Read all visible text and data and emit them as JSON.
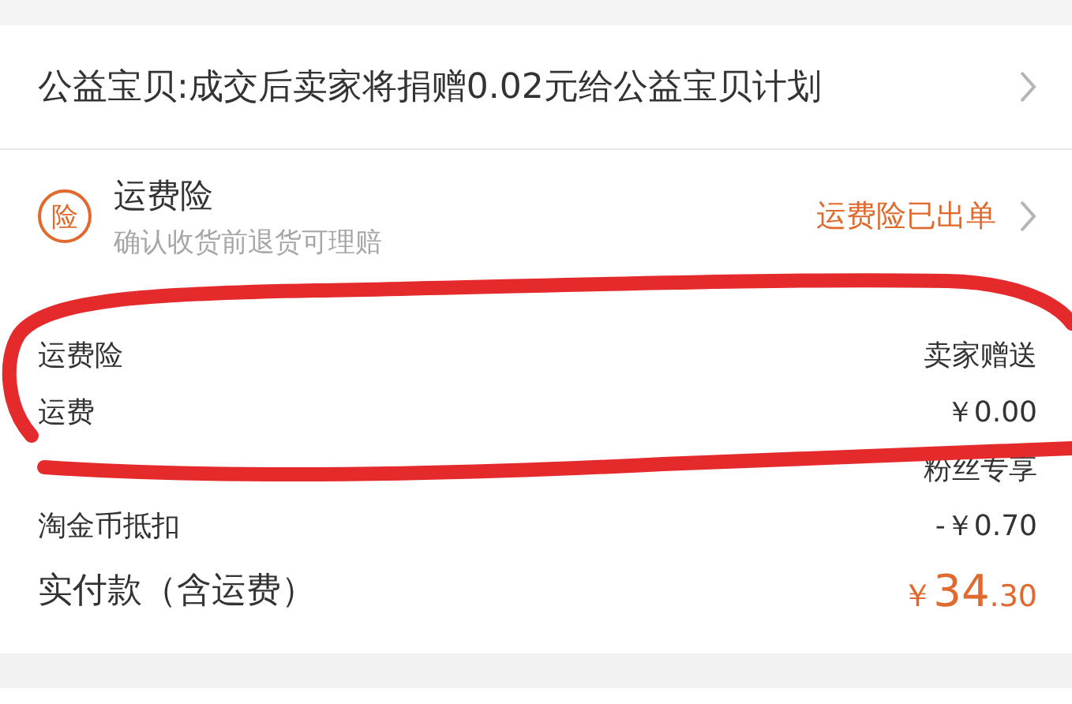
{
  "charity": {
    "text": "公益宝贝:成交后卖家将捐赠0.02元给公益宝贝计划"
  },
  "insurance": {
    "icon_char": "险",
    "title": "运费险",
    "subtitle": "确认收货前退货可理赔",
    "status": "运费险已出单"
  },
  "summary": [
    {
      "label": "运费险",
      "value": "卖家赠送",
      "kind": "plain"
    },
    {
      "label": "运费",
      "value": "￥0.00",
      "kind": "plain"
    },
    {
      "value": "粉丝专享",
      "kind": "note"
    },
    {
      "label": "淘金币抵扣",
      "value": "-￥0.70",
      "kind": "plain"
    }
  ],
  "total": {
    "label": "实付款（含运费）",
    "currency": "￥",
    "integer": "34",
    "decimal": ".30"
  }
}
